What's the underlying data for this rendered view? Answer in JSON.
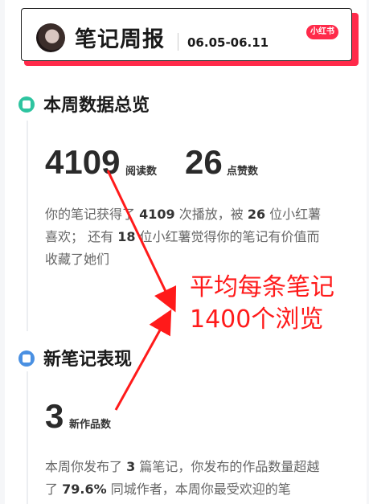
{
  "header": {
    "title": "笔记周报",
    "date_range": "06.05-06.11",
    "brand_badge": "小红书"
  },
  "overview": {
    "title": "本周数据总览",
    "reads_value": "4109",
    "reads_label": "阅读数",
    "likes_value": "26",
    "likes_label": "点赞数",
    "desc": {
      "p1": "你的笔记获得了 ",
      "reads": "4109",
      "p2": " 次播放，被 ",
      "likes": "26",
      "p3": " 位小红薯喜欢； 还有 ",
      "saves": "18",
      "p4": " 位小红薯觉得你的笔记有价值而收藏了她们"
    }
  },
  "new_notes": {
    "title": "新笔记表现",
    "count_value": "3",
    "count_label": "新作品数",
    "desc": {
      "p1": "本周你发布了 ",
      "count": "3",
      "p2": " 篇笔记，你发布的作品数量超越了 ",
      "percent": "79.6%",
      "p3": " 同城作者，本周你最受欢迎的笔"
    }
  },
  "annotation": {
    "line1": "平均每条笔记",
    "line2": "1400个浏览"
  },
  "colors": {
    "brand": "#ff2a4a",
    "overview_icon": "#2ec4a0",
    "new_notes_icon": "#4a90e2",
    "annotation": "#ff1a1a"
  }
}
